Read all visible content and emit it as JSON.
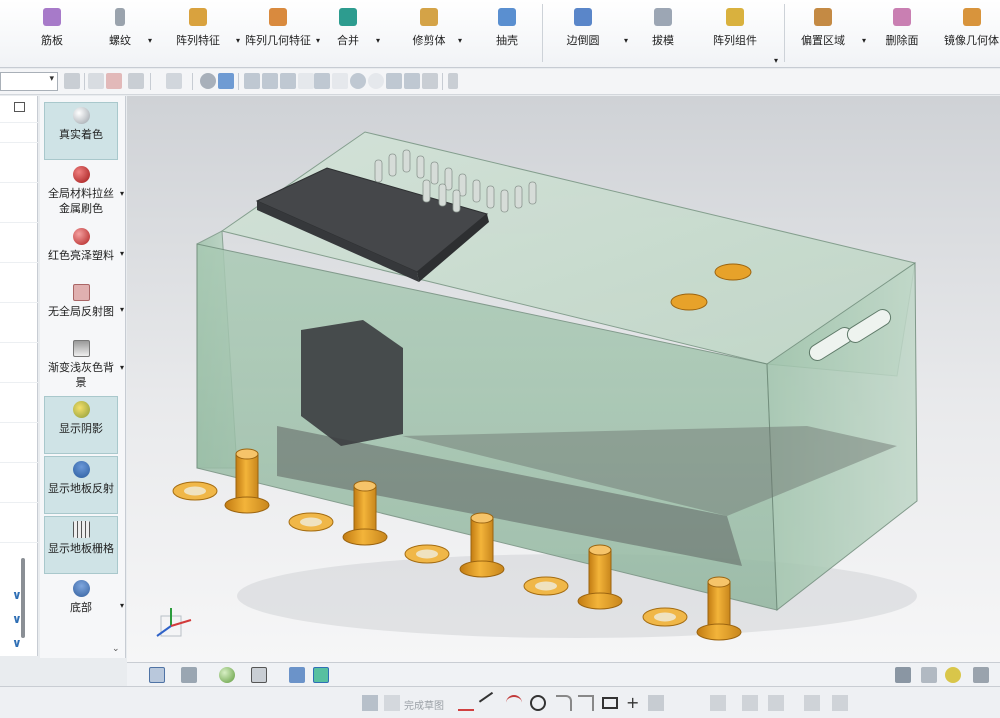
{
  "ribbon": {
    "items": [
      {
        "label": "筋板",
        "icon": "rib-icon",
        "color": "#a77ac9"
      },
      {
        "label": "螺纹",
        "icon": "thread-icon",
        "color": "#9aa3ad"
      },
      {
        "label": "阵列特征",
        "icon": "pattern-feature-icon",
        "color": "#d9a23e"
      },
      {
        "label": "阵列几何特征",
        "icon": "pattern-geometry-icon",
        "color": "#d98a3e"
      },
      {
        "label": "合并",
        "icon": "unite-icon",
        "color": "#2d9c8f"
      },
      {
        "label": "修剪体",
        "icon": "trim-body-icon",
        "color": "#d4a347"
      },
      {
        "label": "抽壳",
        "icon": "shell-icon",
        "color": "#5a8fd0"
      },
      {
        "label": "边倒圆",
        "icon": "edge-blend-icon",
        "color": "#5a86c9"
      },
      {
        "label": "拔模",
        "icon": "draft-icon",
        "color": "#9ca6b4"
      },
      {
        "label": "阵列组件",
        "icon": "pattern-component-icon",
        "color": "#d9b13e"
      },
      {
        "label": "偏置区域",
        "icon": "offset-region-icon",
        "color": "#c48a44"
      },
      {
        "label": "删除面",
        "icon": "delete-face-icon",
        "color": "#c97fb2"
      },
      {
        "label": "镜像几何体",
        "icon": "mirror-geometry-icon",
        "color": "#d8943c"
      }
    ]
  },
  "render_panel": {
    "items": [
      {
        "label": "真实着色",
        "icon": "true-shading-icon",
        "active": true
      },
      {
        "label": "全局材料拉丝金属刷色",
        "icon": "brushed-metal-icon",
        "active": false
      },
      {
        "label": "红色亮泽塑料",
        "icon": "red-plastic-icon",
        "active": false
      },
      {
        "label": "无全局反射图",
        "icon": "no-reflection-icon",
        "active": false
      },
      {
        "label": "渐变浅灰色背景",
        "icon": "gradient-background-icon",
        "active": false
      },
      {
        "label": "显示阴影",
        "icon": "show-shadow-icon",
        "active": true
      },
      {
        "label": "显示地板反射",
        "icon": "floor-reflection-icon",
        "active": true
      },
      {
        "label": "显示地板栅格",
        "icon": "floor-grid-icon",
        "active": true
      },
      {
        "label": "底部",
        "icon": "bottom-view-icon",
        "active": false
      }
    ]
  },
  "statusbar": {
    "sketch_label": "完成草图"
  },
  "colors": {
    "brass": "#e7a22a",
    "translucent_shell": "#9fc7ae",
    "active_panel": "#cfe3e6"
  }
}
